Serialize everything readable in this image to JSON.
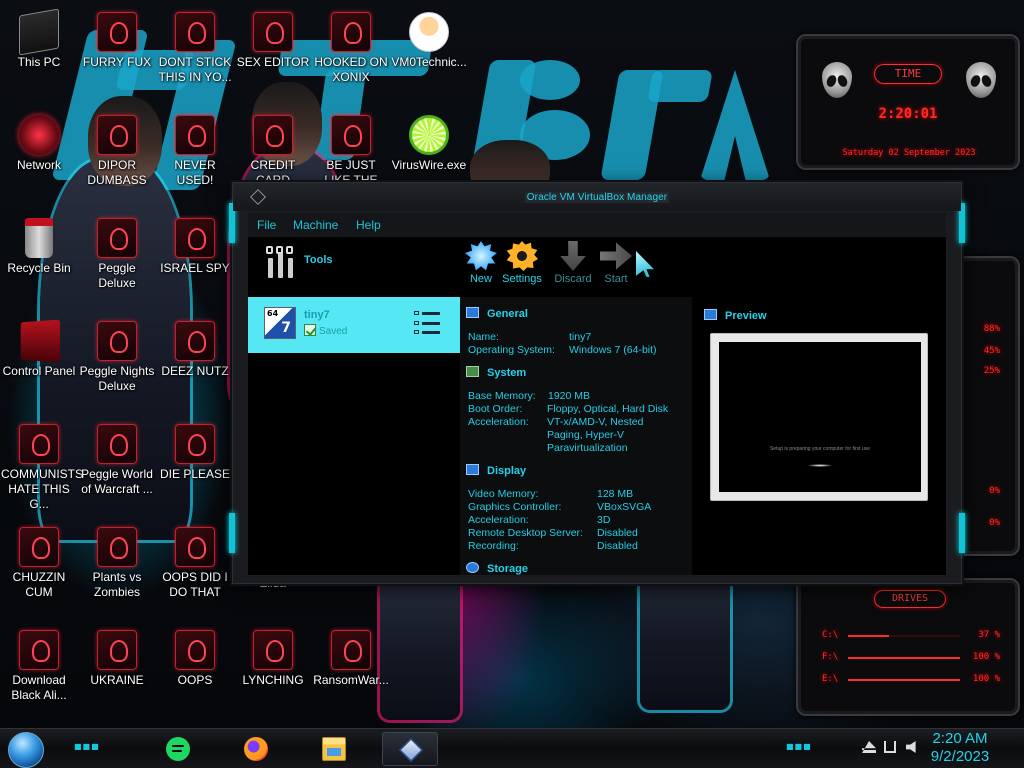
{
  "desktop": {
    "icons": [
      {
        "label": "This PC"
      },
      {
        "label": "FURRY FUX"
      },
      {
        "label": "DONT STICK THIS IN YO..."
      },
      {
        "label": "SEX EDITOR"
      },
      {
        "label": "HOOKED ON XONIX"
      },
      {
        "label": "VM0Technic..."
      },
      {
        "label": "Network"
      },
      {
        "label": "DIPOR DUMBASS"
      },
      {
        "label": "NEVER USED!"
      },
      {
        "label": "CREDIT CARD SWIPER"
      },
      {
        "label": "BE JUST LIKE THE DUDE!"
      },
      {
        "label": "VirusWire.exe"
      },
      {
        "label": "Recycle Bin"
      },
      {
        "label": "Peggle Deluxe"
      },
      {
        "label": "ISRAEL SPY"
      },
      {
        "label": "Control Panel"
      },
      {
        "label": "Peggle Nights Deluxe"
      },
      {
        "label": "DEEZ NUTZ"
      },
      {
        "label": "COMMUNISTS HATE THIS G..."
      },
      {
        "label": "Peggle World of Warcraft ..."
      },
      {
        "label": "DIE PLEASE"
      },
      {
        "label": "CHUZZIN CUM"
      },
      {
        "label": "Plants vs Zombies"
      },
      {
        "label": "OOPS DID I DO THAT"
      },
      {
        "label": "Zilda"
      },
      {
        "label": "Download Black Ali..."
      },
      {
        "label": "UKRAINE"
      },
      {
        "label": "OOPS"
      },
      {
        "label": "LYNCHING"
      },
      {
        "label": "RansomWar..."
      }
    ]
  },
  "gadgets": {
    "clock": {
      "title": "TIME",
      "time": "2:20:01",
      "date": "Saturday 02 September 2023"
    },
    "meters": [
      "88%",
      "45%",
      "25%",
      "0%",
      "0%"
    ],
    "drives": {
      "title": "DRIVES",
      "items": [
        {
          "label": "C:\\",
          "percent": "37 %",
          "fill": 0.37
        },
        {
          "label": "F:\\",
          "percent": "100 %",
          "fill": 1.0
        },
        {
          "label": "E:\\",
          "percent": "100 %",
          "fill": 1.0
        }
      ]
    }
  },
  "vbox": {
    "title": "Oracle VM VirtualBox Manager",
    "menu": [
      "File",
      "Machine",
      "Help"
    ],
    "tools_label": "Tools",
    "vm": {
      "os_badge": "64",
      "os_version": "7",
      "name": "tiny7",
      "state": "Saved"
    },
    "toolbar": [
      {
        "label": "New",
        "enabled": true
      },
      {
        "label": "Settings",
        "enabled": true
      },
      {
        "label": "Discard",
        "enabled": false
      },
      {
        "label": "Start",
        "enabled": false
      }
    ],
    "general": {
      "heading": "General",
      "rows": [
        {
          "key": "Name:",
          "value": "tiny7"
        },
        {
          "key": "Operating System:",
          "value": "Windows 7 (64-bit)"
        }
      ]
    },
    "system": {
      "heading": "System",
      "base_memory_key": "Base Memory:",
      "base_memory": "1920 MB",
      "boot_order_key": "Boot Order:",
      "boot_order": "Floppy, Optical, Hard Disk",
      "acceleration_key": "Acceleration:",
      "acceleration_lines": [
        "VT-x/AMD-V, Nested",
        "Paging, Hyper-V",
        "Paravirtualization"
      ]
    },
    "display": {
      "heading": "Display",
      "rows": [
        {
          "key": "Video Memory:",
          "value": "128 MB"
        },
        {
          "key": "Graphics Controller:",
          "value": "VBoxSVGA"
        },
        {
          "key": "Acceleration:",
          "value": "3D"
        },
        {
          "key": "Remote Desktop Server:",
          "value": "Disabled"
        },
        {
          "key": "Recording:",
          "value": "Disabled"
        }
      ]
    },
    "storage": {
      "heading": "Storage"
    },
    "preview": {
      "heading": "Preview",
      "screen_text": "Setup is preparing your computer for first use"
    }
  },
  "taskbar": {
    "apps": [
      "spotify-icon",
      "firefox-icon",
      "file-explorer-icon",
      "virtualbox-icon"
    ],
    "clock_time": "2:20 AM",
    "clock_date": "9/2/2023"
  }
}
